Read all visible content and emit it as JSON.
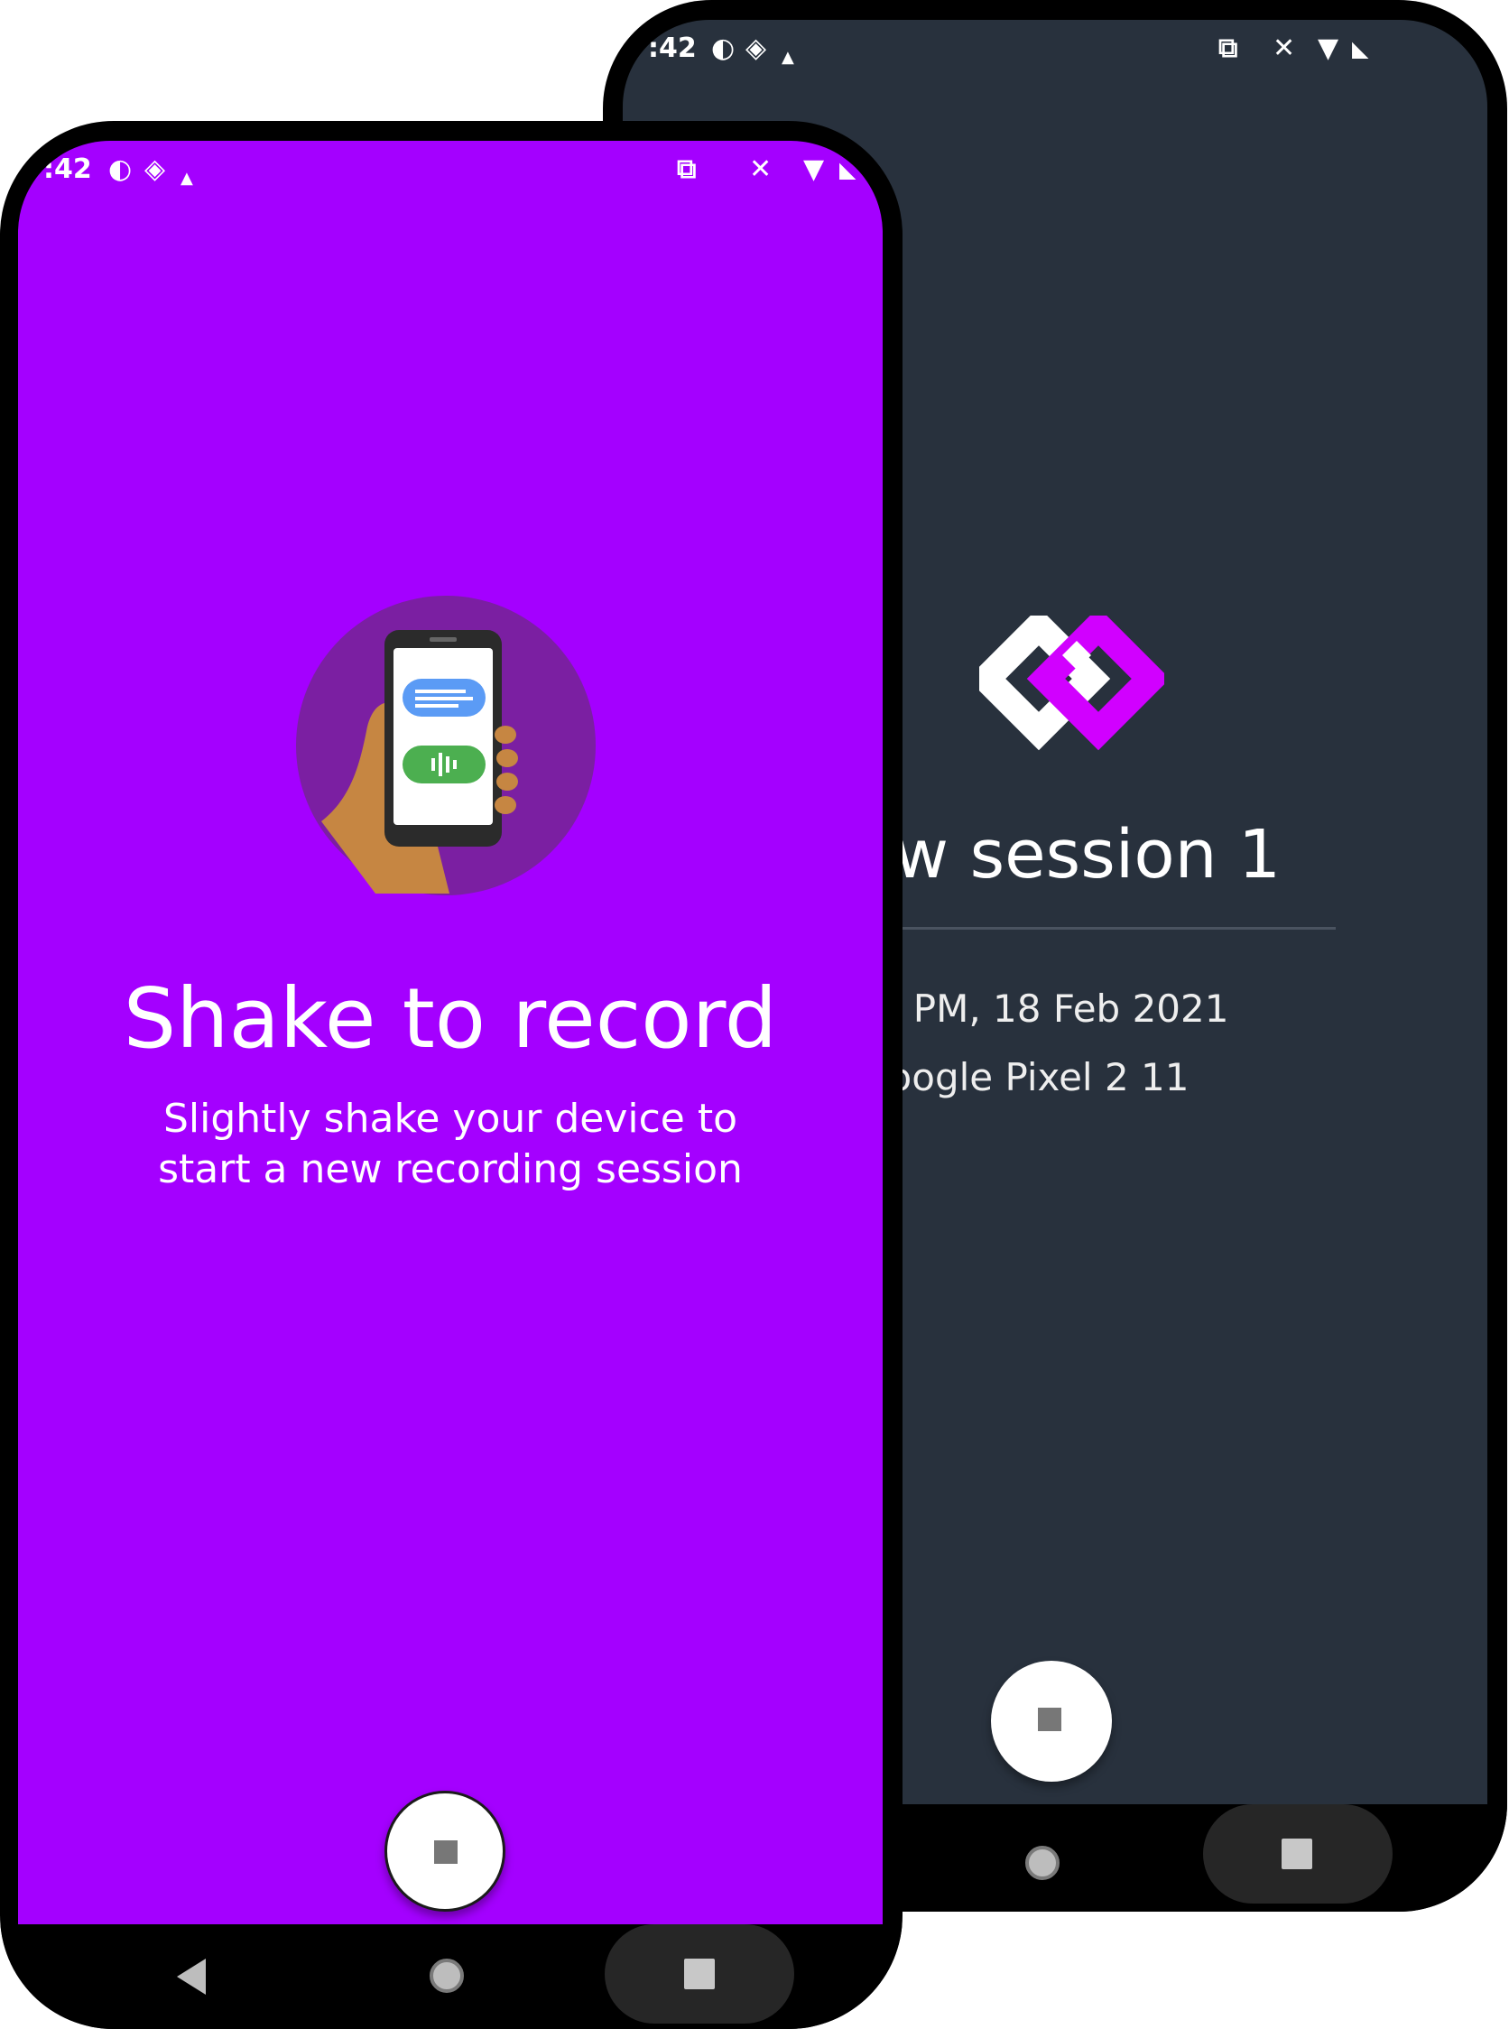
{
  "back_phone": {
    "status_time": ":42",
    "title": "ew session 1",
    "datetime": "42 PM, 18 Feb 2021",
    "device": "Google Pixel 2 11",
    "screen_color": "#28313d",
    "logo_colors": [
      "#ffffff",
      "#d100ff"
    ]
  },
  "front_phone": {
    "status_time": ":42",
    "title": "Shake to record",
    "subtitle": "Slightly shake your device to start a new recording session",
    "screen_color": "#a400ff",
    "illustration": "hand-holding-phone-with-chat-bubbles"
  },
  "icons": {
    "status_left": [
      "circle-icon",
      "double-arrow-icon",
      "small-triangle-icon"
    ],
    "status_right": [
      "cast-icon",
      "bell-off-icon",
      "wifi-icon",
      "battery-icon"
    ],
    "fab": "stop-icon",
    "nav": [
      "back-icon",
      "home-icon",
      "recents-icon"
    ]
  }
}
